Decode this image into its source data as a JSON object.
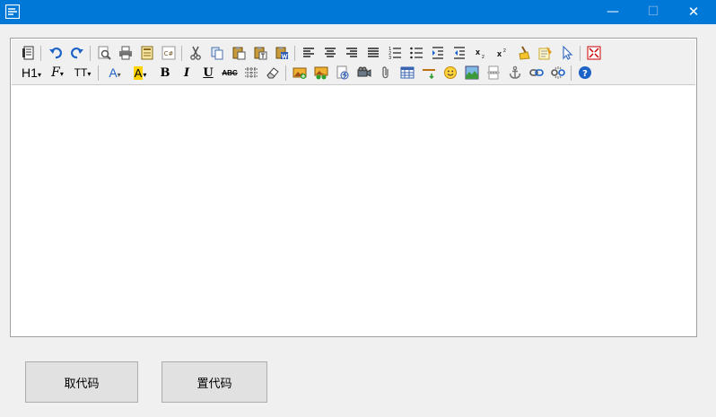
{
  "window": {
    "icon": "app-logo-icon",
    "controls": {
      "minimize": "—",
      "maximize": "☐",
      "close": "✕"
    }
  },
  "toolbar": {
    "row1_icons": [
      "source-code-icon",
      "undo-icon",
      "redo-icon",
      "preview-icon",
      "print-icon",
      "template-icon",
      "code-csharp-icon",
      "cut-icon",
      "copy-icon",
      "paste-icon",
      "paste-text-icon",
      "paste-word-icon",
      "align-left-icon",
      "align-center-icon",
      "align-right-icon",
      "justify-icon",
      "ordered-list-icon",
      "unordered-list-icon",
      "indent-icon",
      "outdent-icon",
      "subscript-icon",
      "superscript-icon",
      "clear-format-icon",
      "select-all-icon",
      "cursor-icon",
      "fullscreen-icon"
    ],
    "row2_icons": [
      "heading-icon",
      "font-family-icon",
      "font-size-icon",
      "font-color-icon",
      "highlight-color-icon",
      "bold-icon",
      "italic-icon",
      "underline-icon",
      "strikethrough-icon",
      "line-height-icon",
      "eraser-icon",
      "insert-image-icon",
      "multi-image-icon",
      "flash-icon",
      "media-icon",
      "attachment-icon",
      "table-icon",
      "horizontal-rule-icon",
      "emoticon-icon",
      "map-icon",
      "page-break-icon",
      "anchor-icon",
      "link-icon",
      "unlink-icon",
      "help-icon"
    ],
    "heading_label": "H1",
    "subscript_label": "x",
    "superscript_label": "x",
    "bold_label": "B",
    "italic_label": "I",
    "underline_label": "U",
    "strike_label": "ABC",
    "font_color_label": "A",
    "highlight_label": "A",
    "font_family_label": "F",
    "font_size_label": "TT",
    "code_label": "C#",
    "help_label": "?"
  },
  "buttons": {
    "get_code": "取代码",
    "set_code": "置代码"
  }
}
